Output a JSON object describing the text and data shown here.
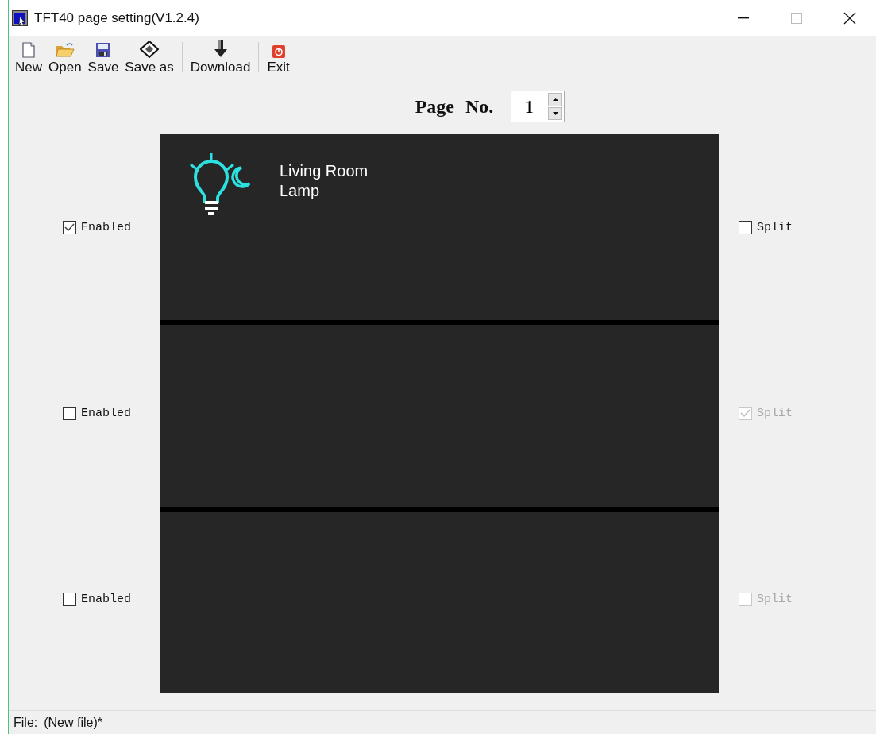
{
  "window": {
    "title": "TFT40 page setting(V1.2.4)"
  },
  "toolbar_groups": [
    {
      "buttons": [
        {
          "label": "New"
        },
        {
          "label": "Open"
        },
        {
          "label": "Save"
        },
        {
          "label": "Save as"
        }
      ]
    },
    {
      "buttons": [
        {
          "label": "Download"
        }
      ]
    },
    {
      "buttons": [
        {
          "label": "Exit"
        }
      ]
    }
  ],
  "page_number": {
    "label": "Page No.",
    "value": "1"
  },
  "sections": [
    {
      "enabled": {
        "label": "Enabled",
        "checked": true,
        "disabled": false
      },
      "split": {
        "label": "Split",
        "checked": false,
        "disabled": false
      },
      "tile": {
        "label": "Living Room Lamp"
      }
    },
    {
      "enabled": {
        "label": "Enabled",
        "checked": false,
        "disabled": false
      },
      "split": {
        "label": "Split",
        "checked": true,
        "disabled": true
      }
    },
    {
      "enabled": {
        "label": "Enabled",
        "checked": false,
        "disabled": false
      },
      "split": {
        "label": "Split",
        "checked": false,
        "disabled": true
      }
    }
  ],
  "status_bar": {
    "file_label": "File:",
    "file_name": "(New file)*"
  }
}
